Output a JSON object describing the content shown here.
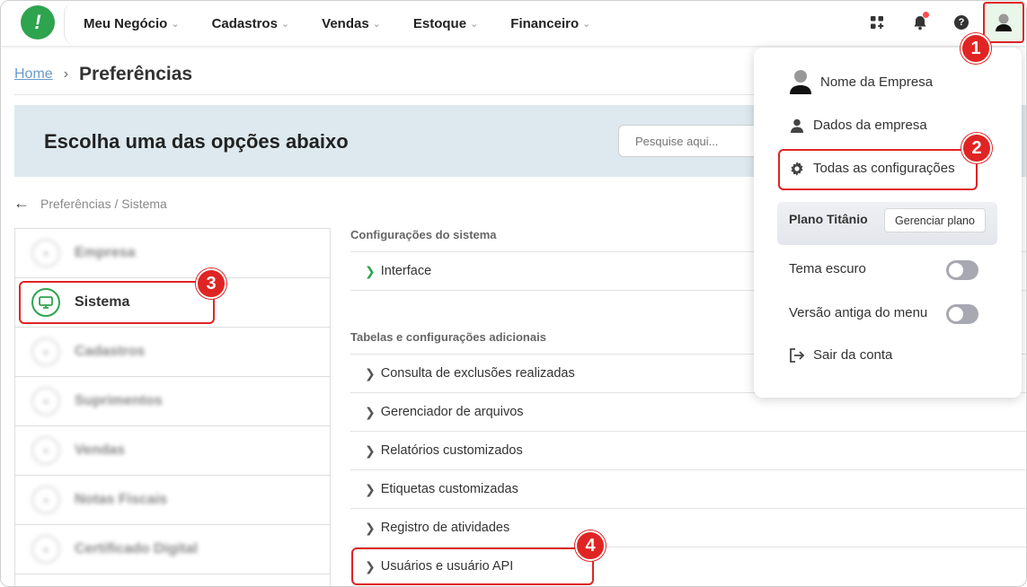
{
  "topnav": {
    "logo_glyph": "!",
    "menu": [
      {
        "label": "Meu Negócio"
      },
      {
        "label": "Cadastros"
      },
      {
        "label": "Vendas"
      },
      {
        "label": "Estoque"
      },
      {
        "label": "Financeiro"
      }
    ],
    "help_glyph": "?"
  },
  "breadcrumb": {
    "home": "Home",
    "current": "Preferências"
  },
  "banner": {
    "title": "Escolha uma das opções abaixo",
    "search_placeholder": "Pesquise aqui..."
  },
  "back": {
    "path": "Preferências / Sistema"
  },
  "sidebar": {
    "items": [
      {
        "label": "Empresa"
      },
      {
        "label": "Sistema"
      },
      {
        "label": "Cadastros"
      },
      {
        "label": "Suprimentos"
      },
      {
        "label": "Vendas"
      },
      {
        "label": "Notas Fiscais"
      },
      {
        "label": "Certificado Digital"
      }
    ]
  },
  "content": {
    "section1": {
      "title": "Configurações do sistema",
      "rows": [
        "Interface"
      ]
    },
    "section2": {
      "title": "Tabelas e configurações adicionais",
      "rows": [
        "Consulta de exclusões realizadas",
        "Gerenciador de arquivos",
        "Relatórios customizados",
        "Etiquetas customizadas",
        "Registro de atividades",
        "Usuários e usuário API"
      ]
    }
  },
  "dropdown": {
    "company_name": "Nome da Empresa",
    "company_data": "Dados da empresa",
    "all_settings": "Todas as configurações",
    "plan_name": "Plano Titânio",
    "manage_plan": "Gerenciar plano",
    "dark_theme": "Tema escuro",
    "old_menu": "Versão antiga do menu",
    "logout": "Sair da conta"
  },
  "badges": [
    "1",
    "2",
    "3",
    "4"
  ],
  "colors": {
    "brand_green": "#2ea44f",
    "highlight_red": "#e02424",
    "banner_bg": "#dde9ee",
    "link_blue": "#6a9ac9"
  }
}
